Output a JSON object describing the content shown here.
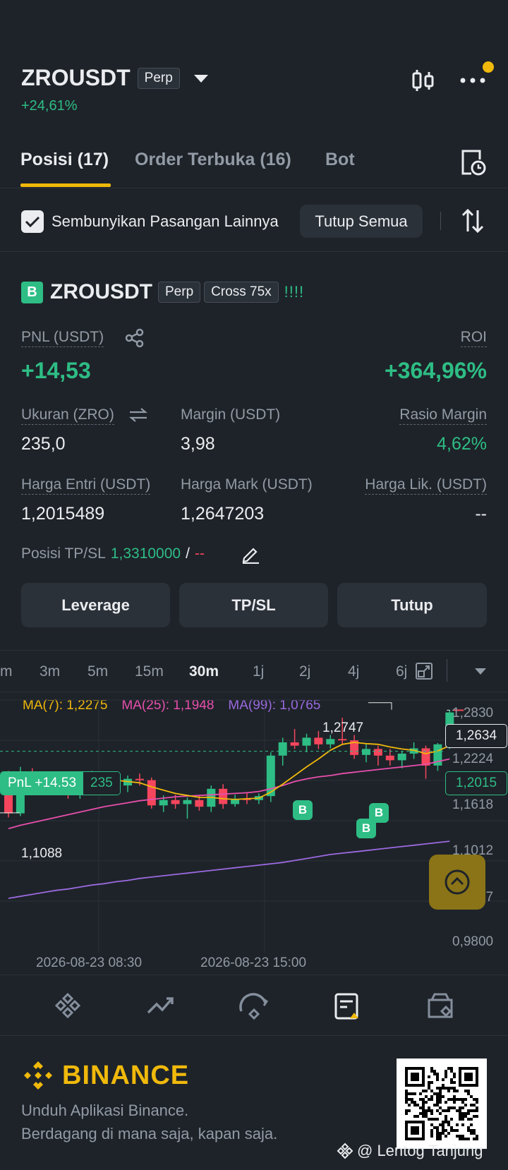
{
  "header": {
    "symbol": "ZROUSDT",
    "type_tag": "Perp",
    "change": "+24,61%"
  },
  "tabs": [
    {
      "label": "Posisi (17)",
      "active": true
    },
    {
      "label": "Order Terbuka (16)",
      "active": false
    },
    {
      "label": "Bot",
      "active": false
    }
  ],
  "filter": {
    "hide_label": "Sembunyikan Pasangan Lainnya",
    "hide_checked": true,
    "close_all_label": "Tutup Semua"
  },
  "position": {
    "side_badge": "B",
    "symbol": "ZROUSDT",
    "type_tag": "Perp",
    "margin_tag": "Cross 75x",
    "risk_marks": "!!!!",
    "pnl_label": "PNL (USDT)",
    "pnl_value": "+14,53",
    "roi_label": "ROI",
    "roi_value": "+364,96%",
    "size_label": "Ukuran (ZRO)",
    "size_value": "235,0",
    "margin_label": "Margin (USDT)",
    "margin_value": "3,98",
    "ratio_label": "Rasio Margin",
    "ratio_value": "4,62%",
    "entry_label": "Harga Entri (USDT)",
    "entry_value": "1,2015489",
    "mark_label": "Harga Mark (USDT)",
    "mark_value": "1,2647203",
    "liq_label": "Harga Lik. (USDT)",
    "liq_value": "--",
    "tpsl_label": "Posisi TP/SL",
    "tp_value": "1,3310000",
    "tpsl_sep": "/",
    "sl_value": "--",
    "buttons": {
      "leverage": "Leverage",
      "tpsl": "TP/SL",
      "close": "Tutup"
    }
  },
  "timeframes": [
    "m",
    "3m",
    "5m",
    "15m",
    "30m",
    "1j",
    "2j",
    "4j",
    "6j"
  ],
  "active_timeframe": "30m",
  "chart_data": {
    "type": "candlestick",
    "ma": [
      {
        "name": "MA(7)",
        "value": "1,2275",
        "color": "#f0b90b"
      },
      {
        "name": "MA(25)",
        "value": "1,1948",
        "color": "#e84fad"
      },
      {
        "name": "MA(99)",
        "value": "1,0765",
        "color": "#9b6ae0"
      }
    ],
    "y_ticks": [
      "1,2830",
      "1,2224",
      "1,1618",
      "1,1012",
      "1,0407",
      "0,9800"
    ],
    "y_tick_values": [
      1.283,
      1.2224,
      1.1618,
      1.1012,
      1.0407,
      0.98
    ],
    "ylim": [
      0.98,
      1.283
    ],
    "x_ticks": [
      "2026-08-23 08:30",
      "2026-08-23 15:00"
    ],
    "current_price_label": "1,2634",
    "current_price": 1.2634,
    "entry_price_label": "1,2015",
    "entry_price": 1.2015,
    "high_label": "1,2747",
    "low_label": "1,1088",
    "pnl_tag": "PnL +14.53",
    "qty_tag": "235",
    "buy_marker": "B",
    "candles": [
      [
        1.165,
        1.172,
        1.102,
        1.108
      ],
      [
        1.108,
        1.178,
        1.104,
        1.17
      ],
      [
        1.17,
        1.176,
        1.15,
        1.16
      ],
      [
        1.16,
        1.168,
        1.145,
        1.152
      ],
      [
        1.152,
        1.165,
        1.14,
        1.148
      ],
      [
        1.148,
        1.162,
        1.13,
        1.136
      ],
      [
        1.136,
        1.16,
        1.13,
        1.155
      ],
      [
        1.155,
        1.172,
        1.15,
        1.166
      ],
      [
        1.166,
        1.17,
        1.15,
        1.156
      ],
      [
        1.156,
        1.166,
        1.145,
        1.15
      ],
      [
        1.15,
        1.165,
        1.14,
        1.16
      ],
      [
        1.16,
        1.168,
        1.15,
        1.158
      ],
      [
        1.158,
        1.162,
        1.115,
        1.12
      ],
      [
        1.12,
        1.135,
        1.11,
        1.128
      ],
      [
        1.128,
        1.136,
        1.115,
        1.122
      ],
      [
        1.122,
        1.132,
        1.1,
        1.128
      ],
      [
        1.128,
        1.135,
        1.112,
        1.118
      ],
      [
        1.118,
        1.15,
        1.11,
        1.145
      ],
      [
        1.145,
        1.152,
        1.115,
        1.122
      ],
      [
        1.122,
        1.136,
        1.118,
        1.13
      ],
      [
        1.13,
        1.14,
        1.122,
        1.128
      ],
      [
        1.128,
        1.138,
        1.122,
        1.134
      ],
      [
        1.134,
        1.2,
        1.125,
        1.195
      ],
      [
        1.195,
        1.222,
        1.18,
        1.215
      ],
      [
        1.215,
        1.235,
        1.205,
        1.21
      ],
      [
        1.21,
        1.228,
        1.2,
        1.222
      ],
      [
        1.222,
        1.232,
        1.205,
        1.212
      ],
      [
        1.212,
        1.226,
        1.206,
        1.22
      ],
      [
        1.22,
        1.252,
        1.212,
        1.218
      ],
      [
        1.218,
        1.226,
        1.19,
        1.196
      ],
      [
        1.196,
        1.212,
        1.185,
        1.205
      ],
      [
        1.205,
        1.21,
        1.18,
        1.195
      ],
      [
        1.195,
        1.205,
        1.18,
        1.188
      ],
      [
        1.188,
        1.202,
        1.176,
        1.198
      ],
      [
        1.198,
        1.215,
        1.19,
        1.206
      ],
      [
        1.206,
        1.21,
        1.16,
        1.18
      ],
      [
        1.18,
        1.214,
        1.172,
        1.212
      ],
      [
        1.212,
        1.264,
        1.205,
        1.26
      ]
    ],
    "ma7": [
      1.14,
      1.145,
      1.15,
      1.154,
      1.156,
      1.158,
      1.158,
      1.158,
      1.159,
      1.158,
      1.156,
      1.154,
      1.148,
      1.143,
      1.138,
      1.135,
      1.132,
      1.132,
      1.13,
      1.129,
      1.13,
      1.131,
      1.14,
      1.152,
      1.165,
      1.178,
      1.19,
      1.203,
      1.212,
      1.215,
      1.213,
      1.212,
      1.208,
      1.205,
      1.203,
      1.198,
      1.202,
      1.21
    ],
    "ma25": [
      1.085,
      1.09,
      1.094,
      1.098,
      1.102,
      1.106,
      1.11,
      1.114,
      1.118,
      1.121,
      1.124,
      1.127,
      1.129,
      1.131,
      1.133,
      1.134,
      1.135,
      1.136,
      1.137,
      1.138,
      1.139,
      1.141,
      1.145,
      1.15,
      1.156,
      1.16,
      1.163,
      1.165,
      1.168,
      1.17,
      1.172,
      1.174,
      1.176,
      1.178,
      1.18,
      1.182,
      1.186,
      1.19
    ],
    "ma99": [
      0.98,
      0.983,
      0.986,
      0.989,
      0.992,
      0.994,
      0.997,
      1.0,
      1.002,
      1.005,
      1.007,
      1.01,
      1.012,
      1.014,
      1.016,
      1.018,
      1.02,
      1.022,
      1.024,
      1.026,
      1.028,
      1.03,
      1.032,
      1.034,
      1.037,
      1.04,
      1.043,
      1.046,
      1.048,
      1.05,
      1.052,
      1.054,
      1.056,
      1.058,
      1.06,
      1.062,
      1.064,
      1.066
    ]
  },
  "bottom_nav": [
    "home-icon",
    "markets-icon",
    "trade-icon",
    "futures-icon",
    "assets-icon"
  ],
  "footer": {
    "brand": "BINANCE",
    "line1": "Unduh Aplikasi Binance.",
    "line2": "Berdagang di mana saja, kapan saja.",
    "watermark": "@ Lentog Tanjung"
  },
  "colors": {
    "up": "#2ebd85",
    "down": "#f6465d",
    "accent": "#f0b90b",
    "bg": "#1e2329",
    "panel": "#2b3139"
  }
}
